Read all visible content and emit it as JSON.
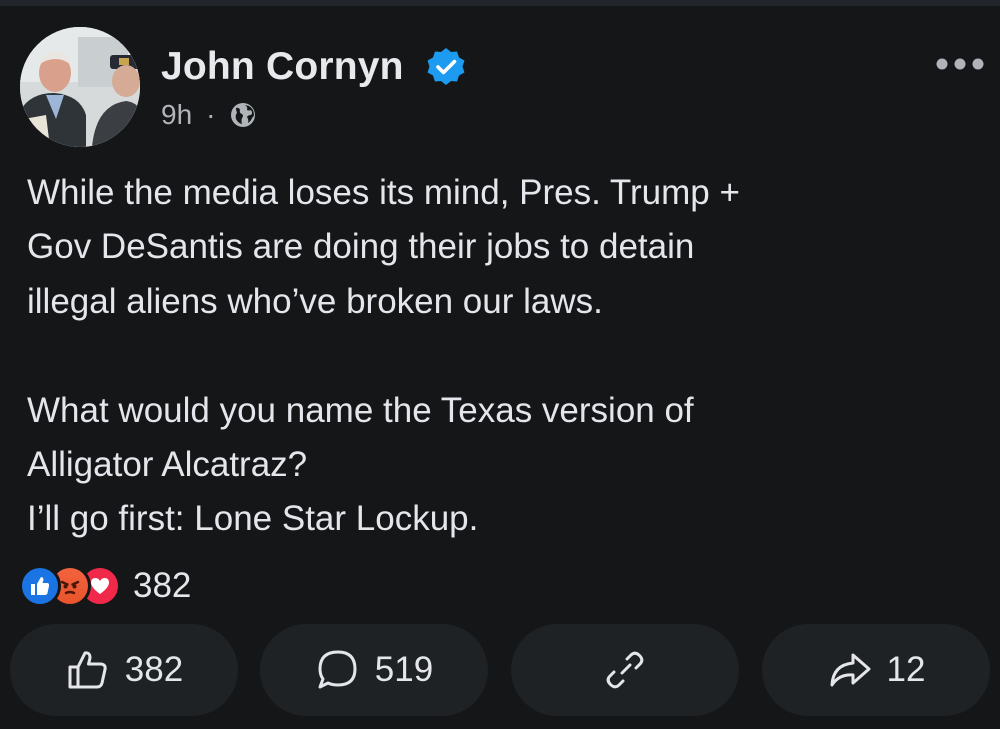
{
  "post": {
    "author": "John Cornyn",
    "time": "9h",
    "separator": "·",
    "text": {
      "line1": "While the media loses its mind, Pres. Trump +",
      "line2": "Gov DeSantis are doing their jobs to detain",
      "line3": "illegal aliens who’ve broken our laws.",
      "line4": "What would you name the Texas version of",
      "line5": "Alligator Alcatraz?",
      "line6": "I’ll go first: Lone Star Lockup."
    }
  },
  "reactions": {
    "types": [
      "like",
      "angry",
      "love"
    ],
    "count": "382"
  },
  "actions": {
    "like_count": "382",
    "comment_count": "519",
    "share_count": "12"
  },
  "icons": {
    "verified": "verified-badge-icon",
    "audience": "globe-icon",
    "more": "more-dots-icon",
    "like": "thumbs-up-icon",
    "comment": "comment-bubble-icon",
    "link": "link-icon",
    "share": "share-arrow-icon"
  },
  "colors": {
    "background": "#141618",
    "button": "#1f2225",
    "verified": "#1d9bf0",
    "like_reaction": "#1b74e4",
    "angry_reaction": "#ee5a33",
    "love_reaction": "#f0284a"
  }
}
